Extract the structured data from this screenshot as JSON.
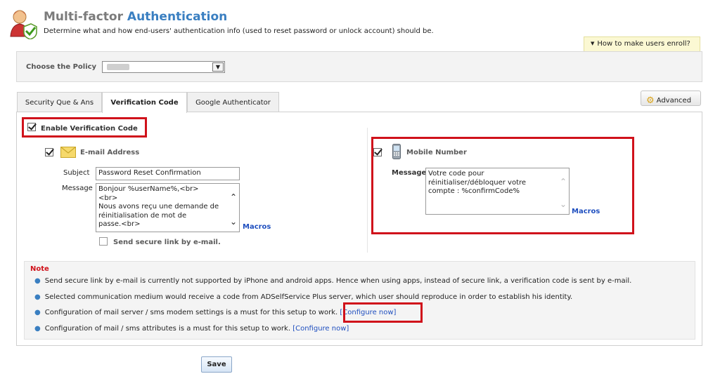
{
  "header": {
    "title_part1": "Multi-factor",
    "title_part2": "Authentication",
    "subtitle": "Determine what and how end-users' authentication info (used to reset password or unlock account) should be.",
    "enroll_link": "How to make users enroll?"
  },
  "policy": {
    "label": "Choose the Policy",
    "selected": ""
  },
  "tabs": [
    {
      "label": "Security Que & Ans",
      "active": false
    },
    {
      "label": "Verification Code",
      "active": true
    },
    {
      "label": "Google Authenticator",
      "active": false
    }
  ],
  "advanced_label": "Advanced",
  "verification": {
    "enable_label": "Enable Verification Code",
    "enable_checked": true,
    "email": {
      "label": "E-mail Address",
      "checked": true,
      "subject_label": "Subject",
      "subject_value": "Password Reset Confirmation",
      "message_label": "Message",
      "message_lines": [
        "Bonjour %userName%,<br>",
        "<br>",
        "Nous avons reçu une demande de",
        "réinitialisation de mot de",
        "passe.<br>"
      ],
      "macros_label": "Macros",
      "secure_link_label": "Send secure link by e-mail.",
      "secure_link_checked": false
    },
    "mobile": {
      "label": "Mobile Number",
      "checked": true,
      "message_label": "Message",
      "message_lines": [
        "Votre code pour",
        "réinitialiser/débloquer votre",
        "compte :  %confirmCode%"
      ],
      "macros_label": "Macros"
    }
  },
  "note": {
    "title": "Note",
    "items": [
      {
        "text": "Send secure link by e-mail is currently not supported by iPhone and android apps. Hence when using apps, instead of secure link, a verification code is sent by e-mail.",
        "link": ""
      },
      {
        "text": "Selected communication medium would receive a code from ADSelfService Plus server, which user should reproduce in order to establish his identity.",
        "link": ""
      },
      {
        "text": "Configuration of mail server / sms modem settings is a must for this setup to work.",
        "link": "[Configure now]"
      },
      {
        "text": "Configuration of mail / sms attributes is a must for this setup to work.",
        "link": "[Configure now]"
      }
    ]
  },
  "save_label": "Save",
  "colors": {
    "title_blue": "#3a7fc1",
    "highlight_red": "#d0121b",
    "link_blue": "#1f4fbf",
    "note_red": "#d0121b"
  }
}
